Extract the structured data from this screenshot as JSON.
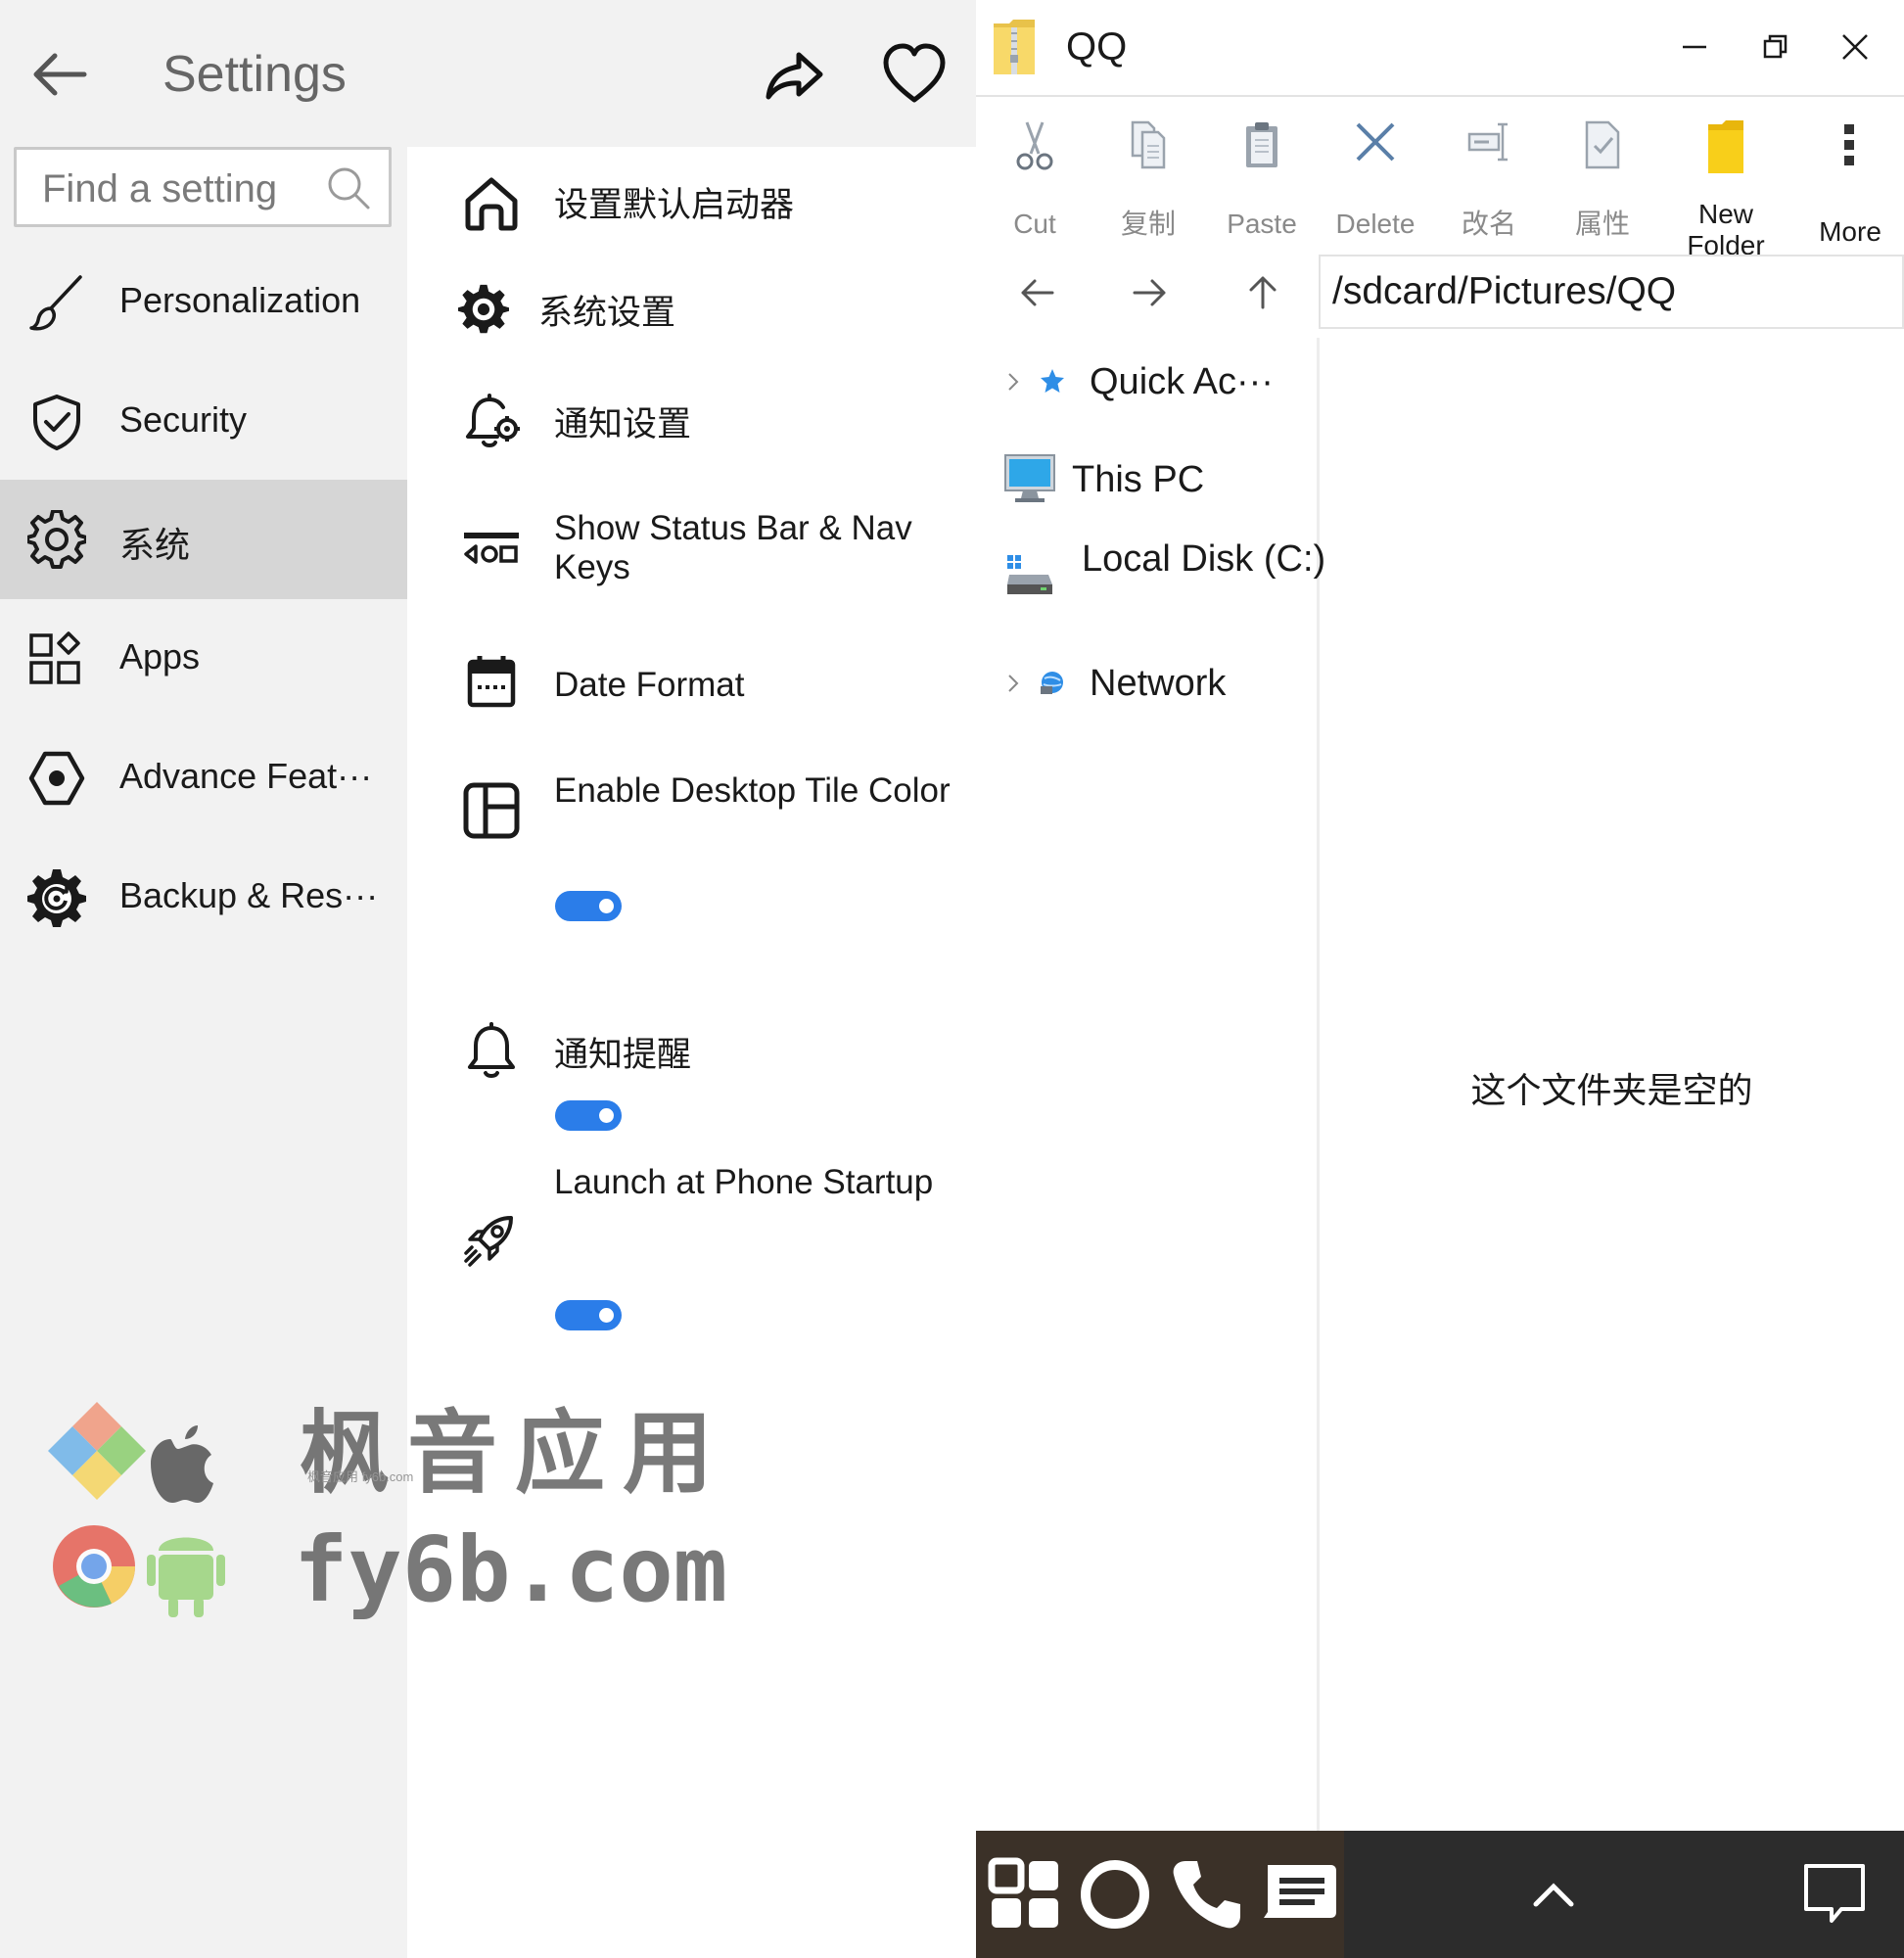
{
  "settings": {
    "title": "Settings",
    "search": {
      "placeholder": "Find a setting",
      "value": ""
    },
    "nav": [
      {
        "label": "Personalization",
        "icon": "brush-icon"
      },
      {
        "label": "Security",
        "icon": "shield-icon"
      },
      {
        "label": "系统",
        "icon": "gear-icon",
        "active": true
      },
      {
        "label": "Apps",
        "icon": "apps-grid-icon"
      },
      {
        "label": "Advance Feat···",
        "icon": "advanced-icon"
      },
      {
        "label": "Backup & Res···",
        "icon": "backup-gear-icon"
      }
    ],
    "options": [
      {
        "label": "设置默认启动器",
        "icon": "home-icon"
      },
      {
        "label": "系统设置",
        "icon": "gear-icon"
      },
      {
        "label": "通知设置",
        "icon": "bell-gear-icon"
      },
      {
        "label": "Show Status Bar & Nav Keys",
        "icon": "statusbar-icon"
      },
      {
        "label": "Date Format",
        "icon": "calendar-icon"
      },
      {
        "label": "Enable Desktop Tile Color",
        "icon": "tile-icon",
        "toggle": true
      },
      {
        "label": "通知提醒",
        "icon": "bell-icon",
        "toggle": true
      },
      {
        "label": "Launch at Phone Startup",
        "icon": "rocket-icon",
        "toggle": true
      }
    ]
  },
  "watermark": {
    "line1": "枫音应用",
    "line2": "fy6b.com",
    "small": "枫音应用 fy6b.com"
  },
  "explorer": {
    "title": "QQ",
    "ribbon": [
      {
        "label": "Cut",
        "icon": "scissors-icon"
      },
      {
        "label": "复制",
        "icon": "copy-icon"
      },
      {
        "label": "Paste",
        "icon": "clipboard-icon"
      },
      {
        "label": "Delete",
        "icon": "delete-x-icon"
      },
      {
        "label": "改名",
        "icon": "rename-icon"
      },
      {
        "label": "属性",
        "icon": "properties-icon"
      },
      {
        "label": "New Folder",
        "icon": "new-folder-icon"
      },
      {
        "label": "More",
        "icon": "more-vertical-icon"
      }
    ],
    "path": "/sdcard/Pictures/QQ",
    "tree": [
      {
        "label": "Quick Ac···",
        "icon": "star-icon",
        "expandable": true
      },
      {
        "label": "This PC",
        "icon": "monitor-icon",
        "expandable": false
      },
      {
        "label": "Local Disk (C:)",
        "icon": "disk-icon",
        "expandable": false
      },
      {
        "label": "Network",
        "icon": "network-icon",
        "expandable": true
      }
    ],
    "empty_message": "这个文件夹是空的"
  },
  "colors": {
    "accent": "#2b7de9",
    "sidebar_bg": "#f2f2f2",
    "active_bg": "#d6d6d6",
    "taskbar": "#2c2c2c",
    "folder": "#f5c518"
  }
}
